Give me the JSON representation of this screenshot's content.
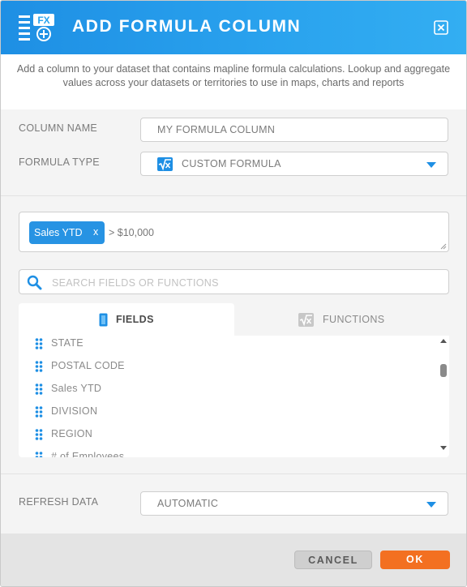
{
  "dialog": {
    "title": "ADD FORMULA COLUMN",
    "header_icon": "formula-column-icon",
    "close_icon": "close-icon",
    "description": "Add a column to your dataset that contains mapline formula calculations. Lookup and aggregate values across your datasets or territories to use in maps, charts and reports"
  },
  "column_name": {
    "label": "COLUMN NAME",
    "value": "MY FORMULA COLUMN"
  },
  "formula_type": {
    "label": "FORMULA TYPE",
    "icon": "square-root-icon",
    "value": "CUSTOM FORMULA"
  },
  "formula": {
    "chip_label": "Sales YTD",
    "chip_remove": "x",
    "expression": "> $10,000"
  },
  "search": {
    "placeholder": "SEARCH FIELDS OR FUNCTIONS",
    "value": ""
  },
  "tabs": [
    {
      "label": "FIELDS",
      "icon": "column-icon",
      "active": true
    },
    {
      "label": "FUNCTIONS",
      "icon": "square-root-icon",
      "active": false
    }
  ],
  "fields": [
    "STATE",
    "POSTAL CODE",
    "Sales YTD",
    "DIVISION",
    "REGION",
    "# of Employees"
  ],
  "refresh": {
    "label": "REFRESH DATA",
    "value": "AUTOMATIC"
  },
  "buttons": {
    "cancel": "CANCEL",
    "ok": "OK"
  },
  "colors": {
    "header": "#2aa3ee",
    "accent": "#1e8fe4",
    "ok_button": "#f37021"
  }
}
